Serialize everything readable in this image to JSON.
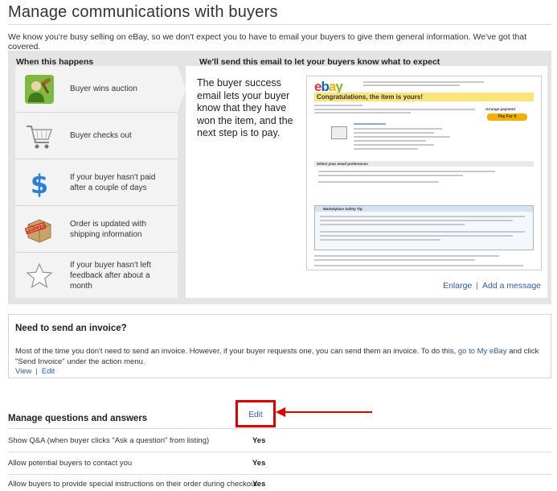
{
  "page": {
    "title": "Manage communications with buyers",
    "intro": "We know you're busy selling on eBay, so we don't expect you to have to email your buyers to give them general information. We've got that covered."
  },
  "panel": {
    "left_heading": "When this happens",
    "right_heading": "We'll send this email to let your buyers know what to expect",
    "events": [
      {
        "label": "Buyer wins auction",
        "icon": "gavel-person-icon"
      },
      {
        "label": "Buyer checks out",
        "icon": "shopping-cart-icon"
      },
      {
        "label": "If your buyer hasn't paid after a couple of days",
        "icon": "dollar-sign-icon"
      },
      {
        "label": "Order is updated with shipping information",
        "icon": "shipped-box-icon"
      },
      {
        "label": "If your buyer hasn't left feedback after about a month",
        "icon": "star-icon"
      }
    ],
    "description": "The buyer success email lets your buyer know that they have won the item, and the next step is to pay.",
    "preview": {
      "banner": "Congratulations, the item is yours!",
      "arrange_payment": "Arrange payment",
      "pay_button": "Pay For It",
      "preferences_heading": "Select your email preferences",
      "safety_heading": "Marketplace Safety Tip"
    },
    "links": {
      "enlarge": "Enlarge",
      "add_message": "Add a message"
    }
  },
  "invoice": {
    "heading": "Need to send an invoice?",
    "text_before": "Most of the time you don't need to send an invoice. However, if your buyer requests one, you can send them an invoice. To do this,",
    "link": "go to My eBay",
    "text_after": "and click \"Send Invoice\" under the action menu.",
    "view": "View",
    "edit": "Edit"
  },
  "qa": {
    "heading": "Manage questions and answers",
    "edit": "Edit",
    "rows": [
      {
        "label": "Show Q&A (when buyer clicks \"Ask a question\" from listing)",
        "value": "Yes"
      },
      {
        "label": "Allow potential buyers to contact you",
        "value": "Yes"
      },
      {
        "label": "Allow buyers to provide special instructions on their order during checkout",
        "value": "Yes"
      }
    ]
  },
  "colors": {
    "link": "#2a5db0",
    "highlight": "#e00000",
    "panel_bg": "#e4e4e4"
  }
}
